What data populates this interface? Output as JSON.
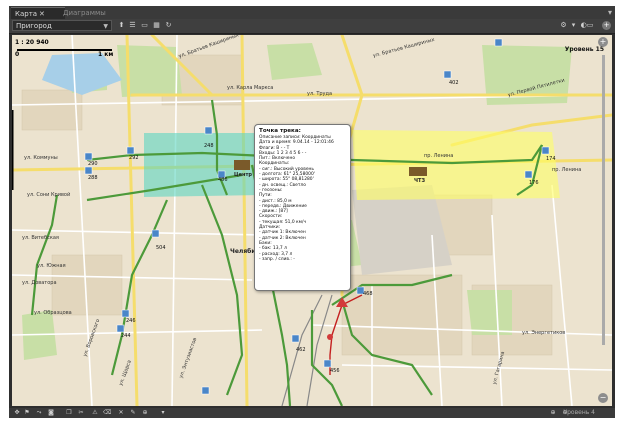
{
  "tabs": [
    {
      "label": "Карта",
      "close": "✕"
    },
    {
      "label": "Диаграммы"
    }
  ],
  "toolbar": {
    "region": "Пригород",
    "tools_left": [
      "pointer-tool-icon",
      "layers-icon",
      "ruler-icon",
      "grid-icon",
      "refresh-icon"
    ],
    "tools_right": [
      "settings-icon",
      "chevron-down-icon",
      "brightness-icon",
      "add-icon"
    ]
  },
  "map": {
    "scale": "1 : 20 940",
    "scale_start": "0",
    "scale_end": "1 км",
    "level": "Уровень 15",
    "zoom_in": "+",
    "zoom_out": "−",
    "streets": {
      "bratyev_kashirinykh": "ул. Братьев Кашириных",
      "bratyev_kashirinykh2": "ул. Братьев Кашириных",
      "karla_marksa": "ул. Карла Маркса",
      "truda": "ул. Труда",
      "lenina": "пр. Ленина",
      "pervoy_pyatiletki": "ул. Первой Пятилетки",
      "lenina_east": "пр. Ленина",
      "sony_krivoy": "ул. Сони Кривой",
      "kommuny": "ул. Коммуны",
      "vitebskaya": "ул. Витебская",
      "yuzhnaya": "ул. Южная",
      "dovatora": "ул. Доватора",
      "obrazcova": "ул. Образцова",
      "vorovskogo": "ул. Воровского",
      "entuziastov": "ул. Энтузиастов",
      "shchorsa": "ул. Щорса",
      "gagarina": "ул. Гагарина",
      "energetikov": "ул. Энергетиков"
    },
    "places": {
      "city_center": "Челяби",
      "tsentr": "Центр",
      "chtz": "ЧТЗ"
    },
    "markers": [
      "292",
      "290",
      "288",
      "248",
      "486",
      "504",
      "402",
      "174",
      "176",
      "468",
      "456",
      "462",
      "246",
      "244"
    ]
  },
  "popup": {
    "title": "Точка трека:",
    "lines": [
      "Описание записи: Координаты",
      "Дата и время: 9.04.14 - 12:01:46",
      "Флаги: В - - Т",
      "Входы: 1 2 3 4 5 6 - -",
      "Пит.: Включено",
      "Координаты:",
      "- сиг.: Высокий уровень",
      "- долгота: 61° 25,58000'",
      "- широта: 55° 08,81280'",
      "- дн. освещ.: Светло",
      "- геозоны:",
      "Пути:",
      "- дист.: 85,0 м",
      "- передв.: Движение",
      "- движ.: [87]",
      "Скорости:",
      "- текущая: 51,0 км/ч",
      "Датчики:",
      "- датчик 1: Включен",
      "- датчик 2: Включен",
      "Баки:",
      "- бак: 13,7 л",
      "- расход: 3,7 л",
      "- запр. / слив.: -"
    ]
  },
  "bottombar": {
    "icons": [
      "pan-icon",
      "flag-icon",
      "route-icon",
      "camera-icon",
      "copy-icon",
      "cut-icon",
      "warning-icon",
      "eraser-icon",
      "close-icon",
      "pencil-icon",
      "target-icon",
      "zoom-in-icon",
      "zoom-out-icon"
    ],
    "level": "Уровень 4"
  },
  "colors": {
    "zone_cyan": "#5ed6c2",
    "zone_yellow": "#ffff66",
    "track": "#4c9a3a",
    "road_yellow": "#f5dd6b"
  }
}
